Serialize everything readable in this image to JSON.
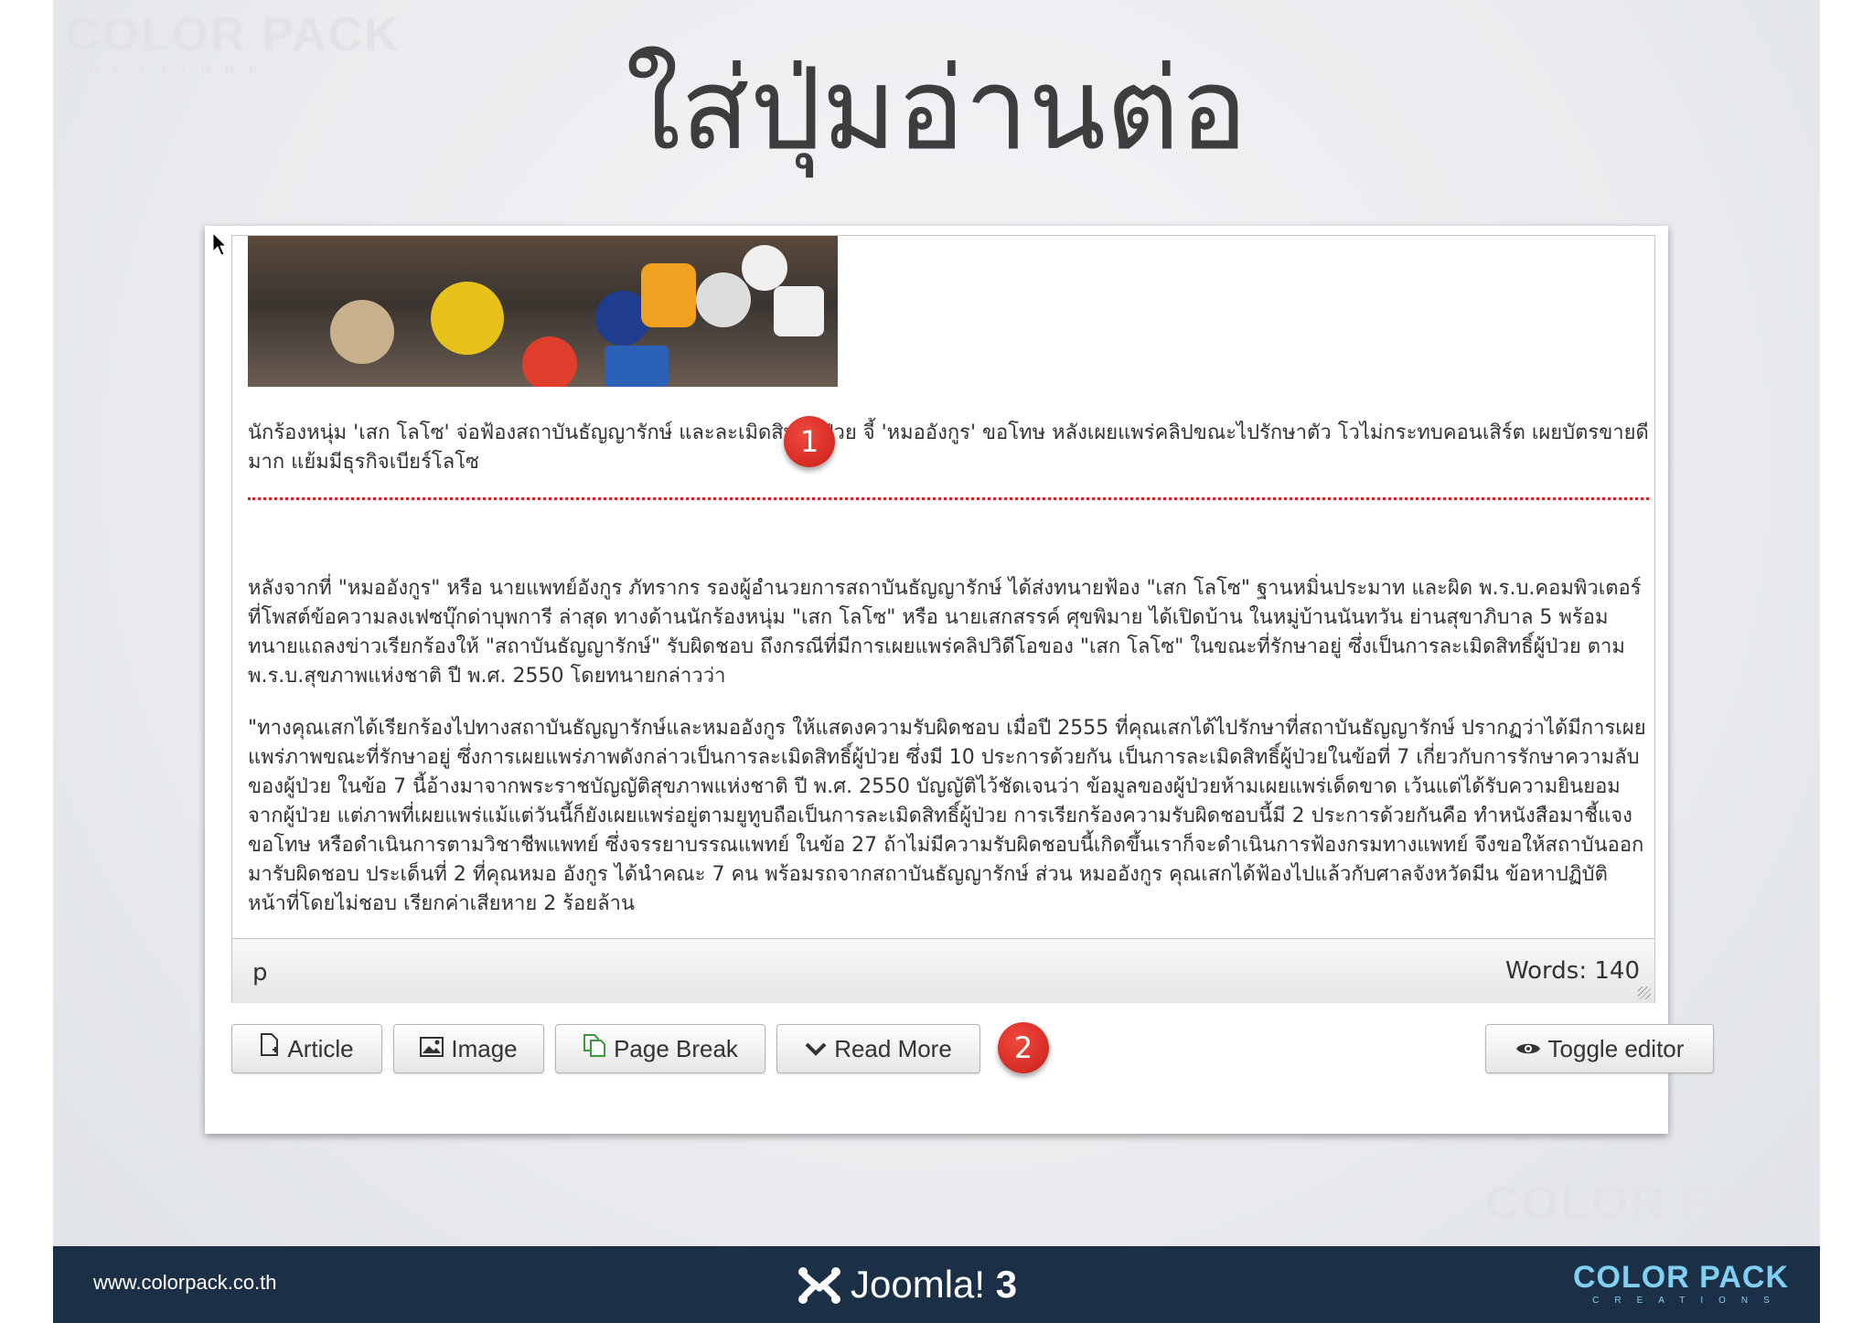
{
  "slide": {
    "title": "ใส่ปุ่มอ่านต่อ",
    "watermark_top": {
      "line1": "COLOR PACK",
      "line2": "CREATIONS"
    },
    "watermark_bottom": {
      "line1": "COLOR PACK"
    }
  },
  "editor": {
    "intro_text": "นักร้องหนุ่ม 'เสก โลโซ' จ่อฟ้องสถาบันธัญญารักษ์ และละเมิดสิทธิ์ผู้ป่วย จี้ 'หมออังกูร' ขอโทษ หลังเผยแพร่คลิปขณะไปรักษาตัว โวไม่กระทบคอนเสิร์ต เผยบัตรขายดีมาก แย้มมีธุรกิจเบียร์โลโซ",
    "paragraph_1": "หลังจากที่ \"หมออังกูร\" หรือ นายแพทย์อังกูร ภัทรากร รองผู้อำนวยการสถาบันธัญญารักษ์ ได้ส่งทนายฟ้อง \"เสก โลโซ\" ฐานหมิ่นประมาท และผิด พ.ร.บ.คอมพิวเตอร์ ที่โพสต์ข้อความลงเฟซบุ๊กด่าบุพการี ล่าสุด ทางด้านนักร้องหนุ่ม \"เสก โลโซ\" หรือ นายเสกสรรค์ ศุขพิมาย ได้เปิดบ้าน ในหมู่บ้านนันทวัน ย่านสุขาภิบาล 5 พร้อมทนายแถลงข่าวเรียกร้องให้ \"สถาบันธัญญารักษ์\" รับผิดชอบ ถึงกรณีที่มีการเผยแพร่คลิปวิดีโอของ \"เสก โลโซ\" ในขณะที่รักษาอยู่ ซึ่งเป็นการละเมิดสิทธิ์ผู้ป่วย ตาม พ.ร.บ.สุขภาพแห่งชาติ ปี พ.ศ. 2550 โดยทนายกล่าวว่า",
    "paragraph_2": "\"ทางคุณเสกได้เรียกร้องไปทางสถาบันธัญญารักษ์และหมออังกูร ให้แสดงความรับผิดชอบ เมื่อปี 2555 ที่คุณเสกได้ไปรักษาที่สถาบันธัญญารักษ์ ปรากฏว่าได้มีการเผยแพร่ภาพขณะที่รักษาอยู่ ซึ่งการเผยแพร่ภาพดังกล่าวเป็นการละเมิดสิทธิ์ผู้ป่วย ซึ่งมี 10 ประการด้วยกัน เป็นการละเมิดสิทธิ์ผู้ป่วยในข้อที่ 7 เกี่ยวกับการรักษาความลับของผู้ป่วย ในข้อ 7 นี้อ้างมาจากพระราชบัญญัติสุขภาพแห่งชาติ ปี พ.ศ. 2550 บัญญัติไว้ชัดเจนว่า ข้อมูลของผู้ป่วยห้ามเผยแพร่เด็ดขาด เว้นแต่ได้รับความยินยอมจากผู้ป่วย แต่ภาพที่เผยแพร่แม้แต่วันนี้ก็ยังเผยแพร่อยู่ตามยูทูบถือเป็นการละเมิดสิทธิ์ผู้ป่วย การเรียกร้องความรับผิดชอบนี้มี 2 ประการด้วยกันคือ ทำหนังสือมาชี้แจงขอโทษ หรือดำเนินการตามวิชาชีพแพทย์ ซึ่งจรรยาบรรณแพทย์ ในข้อ 27 ถ้าไม่มีความรับผิดชอบนี้เกิดขึ้นเราก็จะดำเนินการฟ้องกรมทางแพทย์ จึงขอให้สถาบันออกมารับผิดชอบ ประเด็นที่ 2 ที่คุณหมอ อังกูร ได้นำคณะ 7 คน พร้อมรถจากสถาบันธัญญารักษ์ ส่วน หมออังกูร คุณเสกได้ฟ้องไปแล้วกับศาลจังหวัดมีน ข้อหาปฏิบัติหน้าที่โดยไม่ชอบ เรียกค่าเสียหาย 2 ร้อยล้าน",
    "status_path": "p",
    "word_count": "Words: 140"
  },
  "markers": {
    "m1": "1",
    "m2": "2"
  },
  "buttons": {
    "article": "Article",
    "image": "Image",
    "page_break": "Page Break",
    "read_more": "Read More",
    "toggle_editor": "Toggle editor"
  },
  "footer": {
    "url": "www.colorpack.co.th",
    "joomla": "Joomla!",
    "joomla_version": "3",
    "brand_line1": "COLOR PACK",
    "brand_line2": "CREATIONS"
  },
  "colors": {
    "footer_bg": "#1b3047",
    "marker": "#d52b23",
    "pagebreak": "#d8202a",
    "brand": "#7fd0f2"
  }
}
